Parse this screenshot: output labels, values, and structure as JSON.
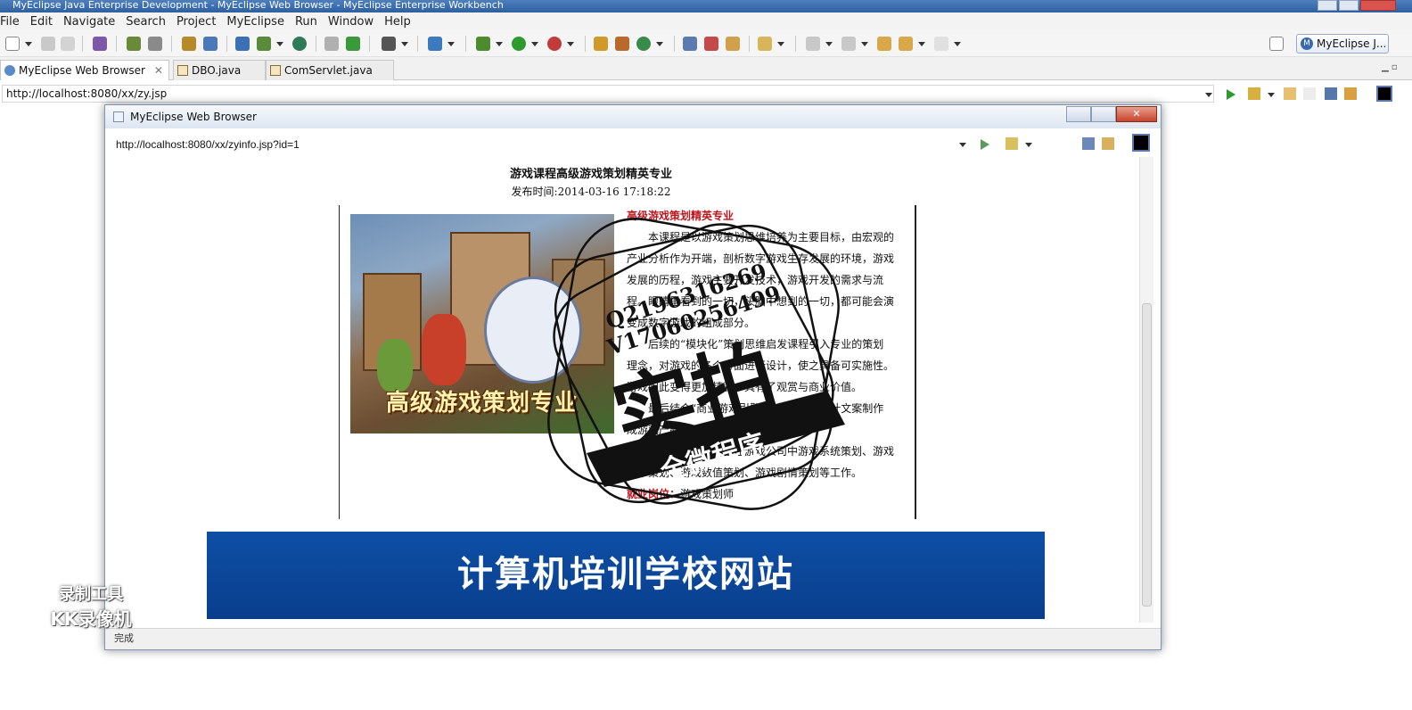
{
  "window": {
    "title": "MyEclipse Java Enterprise Development - MyEclipse Web Browser - MyEclipse Enterprise Workbench"
  },
  "menu": [
    "File",
    "Edit",
    "Navigate",
    "Search",
    "Project",
    "MyEclipse",
    "Run",
    "Window",
    "Help"
  ],
  "perspective": {
    "label": "MyEclipse J...",
    "icon": "myeclipse-perspective-icon"
  },
  "tabs": [
    {
      "label": "MyEclipse Web Browser",
      "icon": "globe-icon",
      "active": true
    },
    {
      "label": "DBO.java",
      "icon": "java-file-icon",
      "active": false
    },
    {
      "label": "ComServlet.java",
      "icon": "java-file-icon",
      "active": false
    }
  ],
  "editor_url": "http://localhost:8080/xx/zy.jsp",
  "popup": {
    "title": "MyEclipse Web Browser",
    "url": "http://localhost:8080/xx/zyinfo.jsp?id=1",
    "status": "完成"
  },
  "article": {
    "title": "游戏课程高级游戏策划精英专业",
    "publish_label": "发布时间:",
    "publish_date": "2014-03-16 17:18:22",
    "image_caption": "高级游戏策划专业",
    "heading": "高级游戏策划精英专业",
    "paragraphs": [
      "本课程是以游戏策划思维培养为主要目标，由宏观的产业分析作为开端，剖析数字游戏生存发展的环境，游戏发展的历程，游戏主要开发技术，游戏开发的需求与流程。眼睛里看到的一切，头脑中想到的一切，都可能会演变成数字游戏的组成部分。",
      "后续的“模块化”策划思维启发课程引入专业的策划理念，对游戏的各个方面进行设计，使之具备可实施性。游戏因此变得更加精彩，具有了观赏与商业价值。",
      "最后结合“商业游戏引擎”，将成熟的设计文案制作成游戏产品。",
      "学员毕业后可以胜任游戏公司中游戏系统策划、游戏关卡策划、游戏数值策划、游戏剧情策划等工作。"
    ],
    "job_label": "就业岗位：",
    "job_value": "游戏策划师"
  },
  "banner": {
    "text": "计算机培训学校网站"
  },
  "watermark": {
    "stamp_big": "实拍",
    "stamp_ribbon": "全微程序",
    "stamp_line1": "Q2196316269",
    "stamp_line2": "V17060256499",
    "recorder_line1": "录制工具",
    "recorder_line2": "KK录像机"
  },
  "colors": {
    "accent": "#0d4fa6",
    "red_heading": "#c0141c",
    "title_bar": "#2f5f9f"
  }
}
